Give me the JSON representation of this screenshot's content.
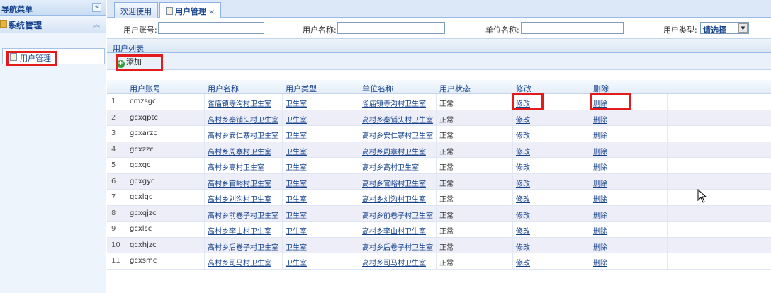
{
  "nav": {
    "title": "导航菜单",
    "collapse_icon": "double-chevron-left-icon",
    "group_title": "系统管理",
    "group_toggle_icon": "double-chevron-up-icon",
    "items": [
      {
        "label": "用户管理"
      }
    ]
  },
  "tabs": [
    {
      "label": "欢迎使用"
    },
    {
      "label": "用户管理",
      "close": "×"
    }
  ],
  "search": {
    "account_label": "用户账号:",
    "account_value": "",
    "name_label": "用户名称:",
    "name_value": "",
    "unit_label": "单位名称:",
    "unit_value": "",
    "type_label": "用户类型:",
    "type_selected": "请选择"
  },
  "panel": {
    "title": "用户列表",
    "add_label": "添加"
  },
  "grid": {
    "columns": [
      "用户账号",
      "用户名称",
      "用户类型",
      "单位名称",
      "用户状态",
      "修改",
      "删除"
    ],
    "edit_label": "修改",
    "delete_label": "删除",
    "rows": [
      {
        "no": "1",
        "account": "cmzsgc",
        "name": "雀庙镇寺沟村卫生室",
        "type": "卫生室",
        "unit": "雀庙镇寺沟村卫生室",
        "status": "正常"
      },
      {
        "no": "2",
        "account": "gcxqptc",
        "name": "高村乡秦铺头村卫生室",
        "type": "卫生室",
        "unit": "高村乡秦铺头村卫生室",
        "status": "正常"
      },
      {
        "no": "3",
        "account": "gcxarzc",
        "name": "高村乡安仁寨村卫生室",
        "type": "卫生室",
        "unit": "高村乡安仁寨村卫生室",
        "status": "正常"
      },
      {
        "no": "4",
        "account": "gcxzzc",
        "name": "高村乡周寨村卫生室",
        "type": "卫生室",
        "unit": "高村乡周寨村卫生室",
        "status": "正常"
      },
      {
        "no": "5",
        "account": "gcxgc",
        "name": "高村乡高村卫生室",
        "type": "卫生室",
        "unit": "高村乡高村卫生室",
        "status": "正常"
      },
      {
        "no": "6",
        "account": "gcxgyc",
        "name": "高村乡官峪村卫生室",
        "type": "卫生室",
        "unit": "高村乡官峪村卫生室",
        "status": "正常"
      },
      {
        "no": "7",
        "account": "gcxlgc",
        "name": "高村乡刘沟村卫生室",
        "type": "卫生室",
        "unit": "高村乡刘沟村卫生室",
        "status": "正常"
      },
      {
        "no": "8",
        "account": "gcxqjzc",
        "name": "高村乡前卷子村卫生室",
        "type": "卫生室",
        "unit": "高村乡前卷子村卫生室",
        "status": "正常"
      },
      {
        "no": "9",
        "account": "gcxlsc",
        "name": "高村乡李山村卫生室",
        "type": "卫生室",
        "unit": "高村乡李山村卫生室",
        "status": "正常"
      },
      {
        "no": "10",
        "account": "gcxhjzc",
        "name": "高村乡后卷子村卫生室",
        "type": "卫生室",
        "unit": "高村乡后卷子村卫生室",
        "status": "正常"
      },
      {
        "no": "11",
        "account": "gcxsmc",
        "name": "高村乡司马村卫生室",
        "type": "卫生室",
        "unit": "高村乡司马村卫生室",
        "status": "正常"
      }
    ]
  },
  "icons": {
    "group": "folder-icon",
    "nav_item": "document-icon",
    "tab": "document-icon",
    "add": "add-icon",
    "select_arrow": "chevron-down-icon",
    "cursor": "mouse-cursor-icon"
  },
  "colors": {
    "highlight": "#e31b1b",
    "header_blue": "#15428b",
    "border": "#99bbe8"
  }
}
